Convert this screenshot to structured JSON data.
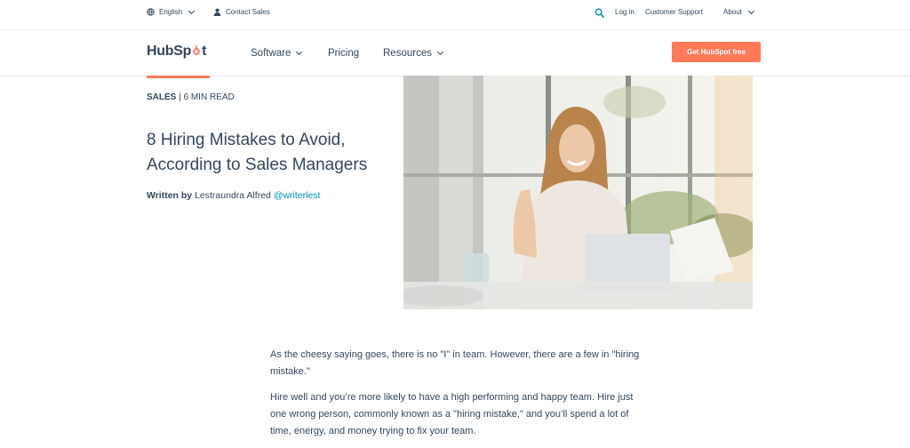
{
  "utility_bar": {
    "language": "English",
    "contact": "Contact Sales",
    "login": "Log in",
    "support": "Customer Support",
    "about": "About"
  },
  "nav": {
    "logo_prefix": "HubSp",
    "logo_suffix": "t",
    "software": "Software",
    "pricing": "Pricing",
    "resources": "Resources",
    "cta": "Get HubSpot free"
  },
  "article": {
    "category": "SALES",
    "separator": " | ",
    "read_time": "6 MIN READ",
    "title": "8 Hiring Mistakes to Avoid, According to Sales Managers",
    "written_by": "Written by",
    "author": "Lestraundra Alfred",
    "handle": "@writerlest",
    "paragraphs": [
      "As the cheesy saying goes, there is no \"I\" in team. However, there are a few in \"hiring mistake.\"",
      "Hire well and you’re more likely to have a high performing and happy team. Hire just one wrong person, commonly known as a \"hiring mistake,\" and you’ll spend a lot of time, energy, and money trying to fix your team."
    ]
  },
  "colors": {
    "accent": "#ff7a59",
    "link": "#0091ae",
    "text": "#33475b"
  }
}
